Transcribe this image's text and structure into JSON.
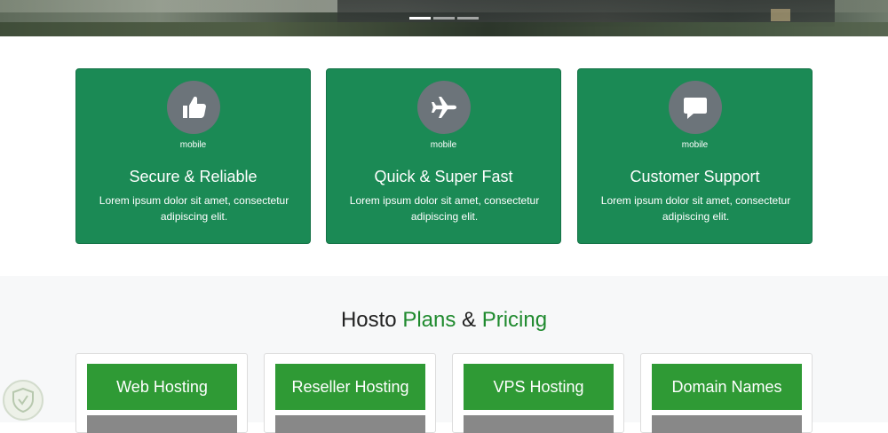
{
  "slider": {
    "dots": 3,
    "active": 0
  },
  "features": [
    {
      "icon": "thumbs-up-icon",
      "icon_label": "mobile",
      "title": "Secure & Reliable",
      "text": "Lorem ipsum dolor sit amet, consectetur adipiscing elit."
    },
    {
      "icon": "plane-icon",
      "icon_label": "mobile",
      "title": "Quick & Super Fast",
      "text": "Lorem ipsum dolor sit amet, consectetur adipiscing elit."
    },
    {
      "icon": "comment-icon",
      "icon_label": "mobile",
      "title": "Customer Support",
      "text": "Lorem ipsum dolor sit amet, consectetur adipiscing elit."
    }
  ],
  "pricing": {
    "title_part1": "Hosto ",
    "title_accent1": "Plans",
    "title_amp": " & ",
    "title_accent2": "Pricing",
    "plans": [
      {
        "name": "Web Hosting"
      },
      {
        "name": "Reseller Hosting"
      },
      {
        "name": "VPS Hosting"
      },
      {
        "name": "Domain Names"
      }
    ]
  },
  "colors": {
    "card_green": "#1b8a55",
    "plan_green": "#2f9a35",
    "accent": "#1f8a2e",
    "icon_circle": "#6c747a"
  }
}
